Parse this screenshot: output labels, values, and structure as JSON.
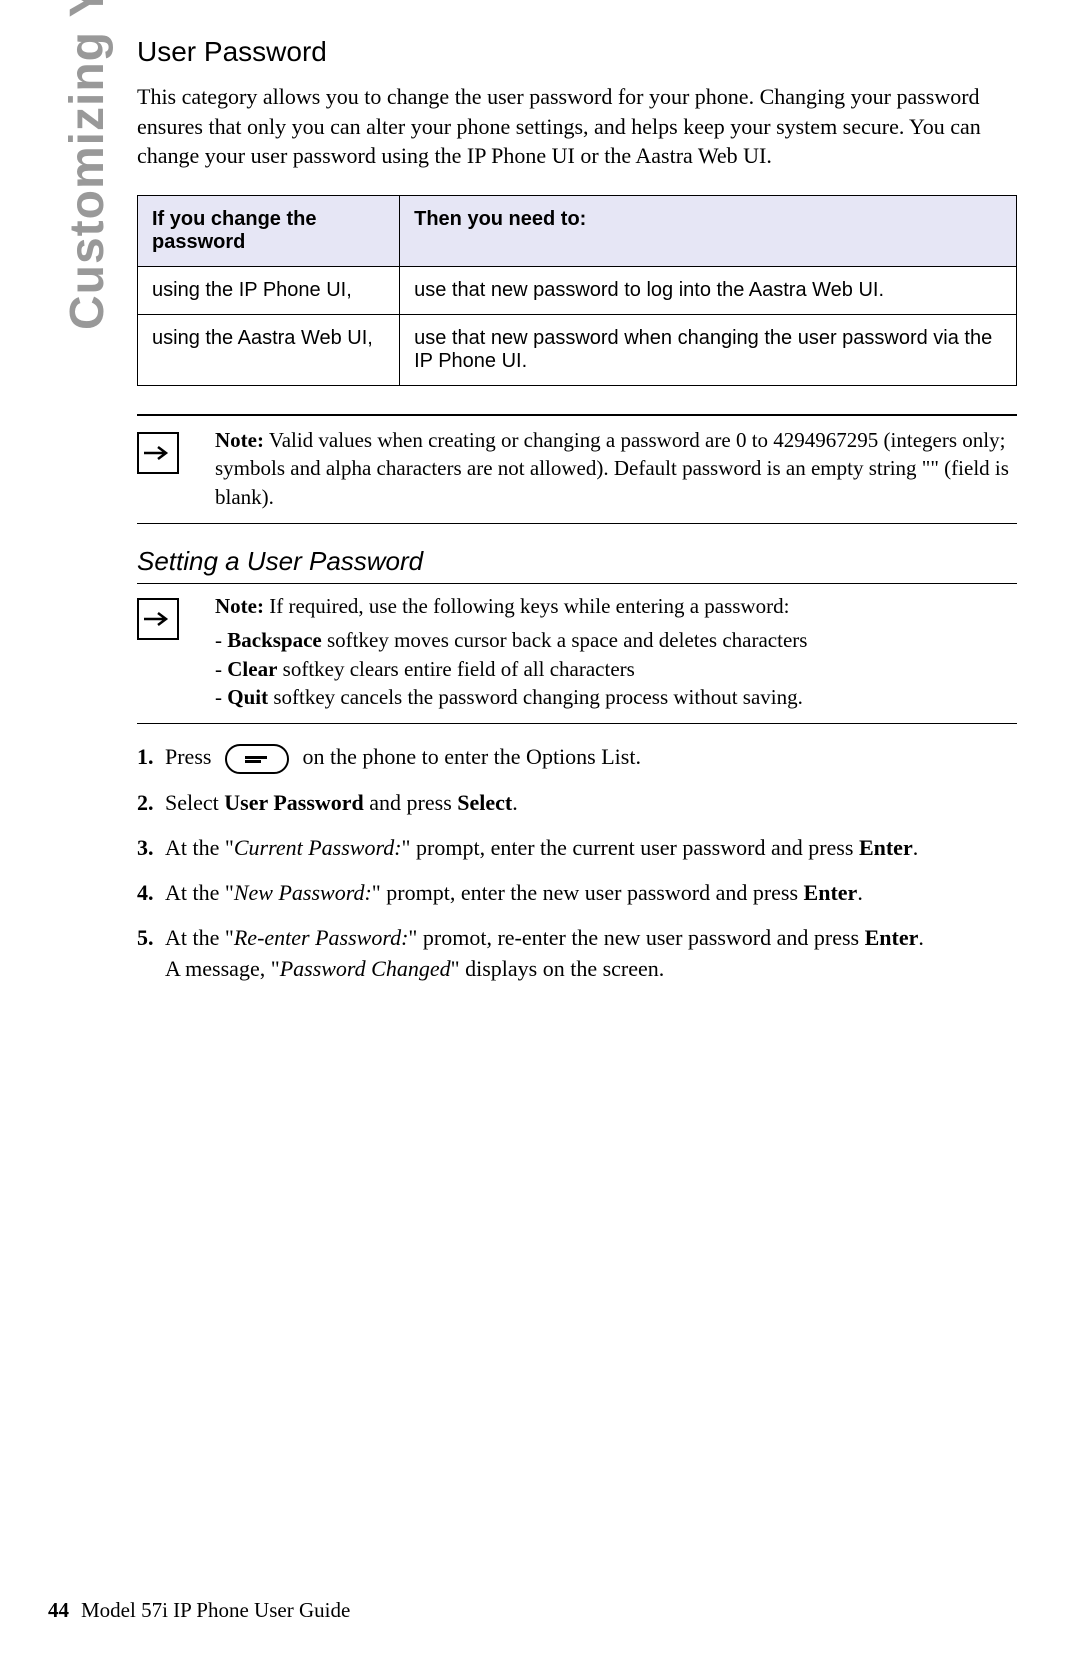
{
  "sidebar": "Customizing Your Phone",
  "heading": "User Password",
  "intro": "This category allows you to change the user password for your phone. Changing your password ensures that only you can alter your phone settings, and helps keep your system secure. You can change your user password using the IP Phone UI or the Aastra Web UI.",
  "table": {
    "header": {
      "c1": "If you change the password",
      "c2": "Then you need to:"
    },
    "rows": [
      {
        "c1": "using the IP Phone UI,",
        "c2": "use that new password to log into the Aastra Web UI."
      },
      {
        "c1": "using the Aastra Web UI,",
        "c2": "use that new password when changing the user password via the IP Phone UI."
      }
    ]
  },
  "note1": {
    "label": "Note:",
    "text": " Valid values when creating or changing a password are 0 to 4294967295 (integers only; symbols and alpha characters are not allowed). Default password is an empty string \"\" (field is blank)."
  },
  "subheading": "Setting a User Password",
  "note2": {
    "label": "Note:",
    "lead": " If required, use the following keys while entering a password:",
    "items": [
      {
        "k": "Backspace",
        "t": " softkey moves cursor back a space and deletes characters"
      },
      {
        "k": "Clear",
        "t": " softkey clears entire field of all characters"
      },
      {
        "k": "Quit",
        "t": " softkey cancels the password changing process without saving."
      }
    ]
  },
  "steps": {
    "s1a": "Press ",
    "s1b": " on the phone to enter the Options List.",
    "s2a": "Select ",
    "s2b": "User Password",
    "s2c": " and press ",
    "s2d": "Select",
    "s2e": ".",
    "s3a": "At the \"",
    "s3b": "Current Password:",
    "s3c": "\" prompt, enter the current user password and press ",
    "s3d": "Enter",
    "s3e": ".",
    "s4a": "At the \"",
    "s4b": "New Password:",
    "s4c": "\" prompt, enter the new user password and press ",
    "s4d": "Enter",
    "s4e": ".",
    "s5a": "At the \"",
    "s5b": "Re-enter Password:",
    "s5c": "\" promot, re-enter the new user password and press ",
    "s5d": "Enter",
    "s5e": ".",
    "s5f": "A message, \"",
    "s5g": "Password Changed",
    "s5h": "\" displays on the screen."
  },
  "footer": {
    "page": "44",
    "title": "Model 57i IP Phone User Guide"
  }
}
